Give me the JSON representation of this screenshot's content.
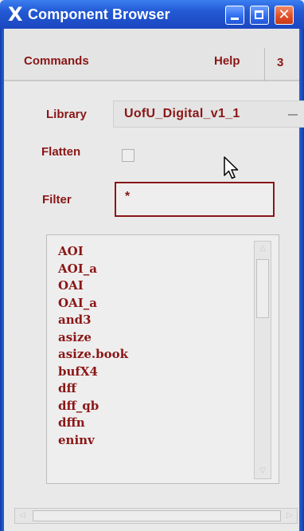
{
  "window": {
    "title": "Component Browser",
    "x_logo": "X",
    "buttons": {
      "minimize": "minimize",
      "maximize": "maximize",
      "close": "✕"
    }
  },
  "menubar": {
    "commands": "Commands",
    "help": "Help",
    "number": "3"
  },
  "form": {
    "library_label": "Library",
    "library_value": "UofU_Digital_v1_1",
    "flatten_label": "Flatten",
    "flatten_checked": false,
    "filter_label": "Filter",
    "filter_value": "*"
  },
  "list": {
    "items": [
      "AOI",
      "AOI_a",
      "OAI",
      "OAI_a",
      "and3",
      "asize",
      "asize.book",
      "bufX4",
      "dff",
      "dff_qb",
      "dffn",
      "eninv"
    ]
  },
  "colors": {
    "accent": "#8a1616",
    "titlebar": "#2359d4",
    "background": "#e9e9e9"
  }
}
